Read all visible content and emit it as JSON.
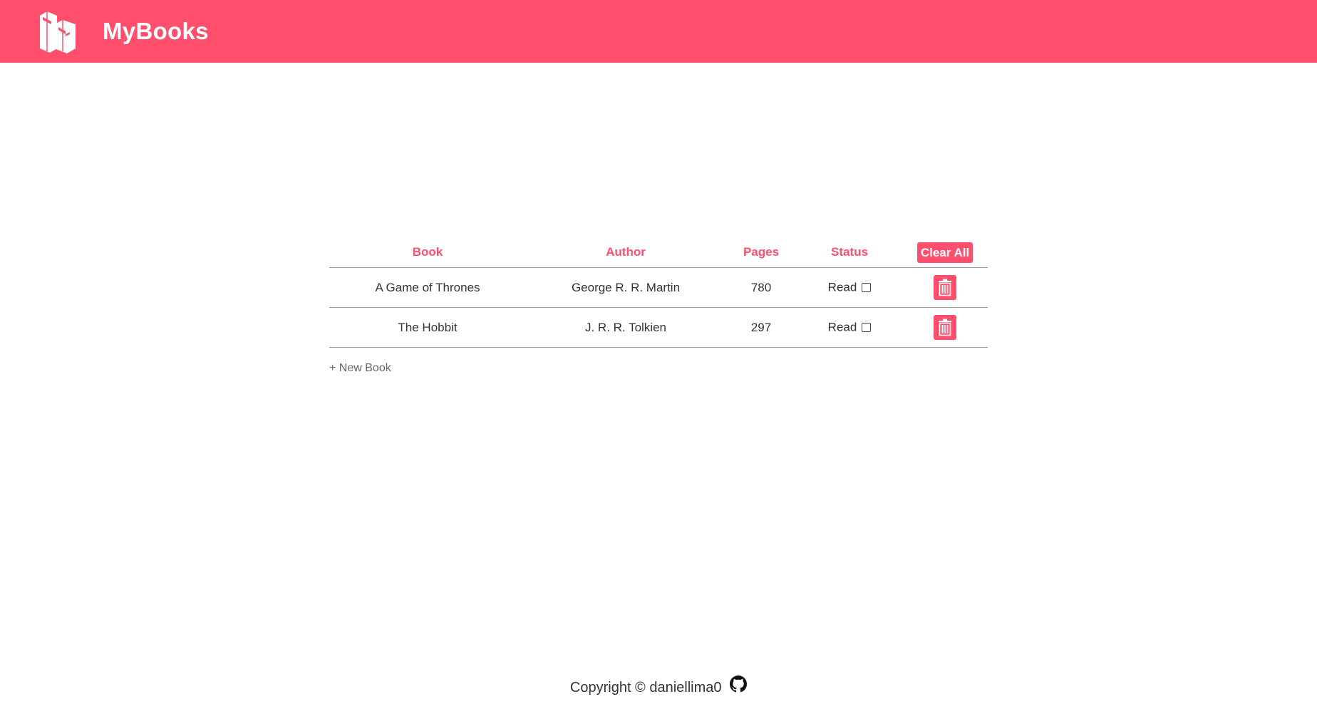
{
  "header": {
    "title": "MyBooks",
    "logo_icon": "books-icon",
    "background_color": "#ff4f6d"
  },
  "table": {
    "columns": {
      "book": "Book",
      "author": "Author",
      "pages": "Pages",
      "status": "Status"
    },
    "clear_all_label": "Clear All",
    "rows": [
      {
        "book": "A Game of Thrones",
        "author": "George R. R. Martin",
        "pages": "780",
        "status": "Read",
        "read_checked": false
      },
      {
        "book": "The Hobbit",
        "author": "J. R. R. Tolkien",
        "pages": "297",
        "status": "Read",
        "read_checked": false
      }
    ],
    "delete_icon": "trash-icon"
  },
  "new_book_label": "+ New Book",
  "footer": {
    "text": "Copyright © daniellima0",
    "icon": "github-icon"
  },
  "colors": {
    "accent": "#ff4f6d",
    "text": "#333333",
    "muted": "#666666"
  }
}
